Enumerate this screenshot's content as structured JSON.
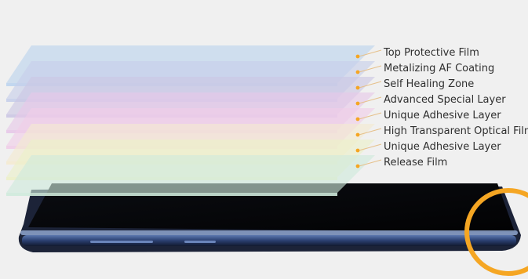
{
  "layers": [
    {
      "label": "Top Protective Film",
      "color": "#bcd4ee"
    },
    {
      "label": "Metalizing AF Coating",
      "color": "#c7cfea"
    },
    {
      "label": "Self Healing Zone",
      "color": "#cbc7e3"
    },
    {
      "label": "Advanced Special Layer",
      "color": "#e7c8e8"
    },
    {
      "label": "Unique Adhesive Layer",
      "color": "#f0cde8"
    },
    {
      "label": "High Transparent Optical Film",
      "color": "#f4ead0"
    },
    {
      "label": "Unique Adhesive Layer",
      "color": "#ecf0c8"
    },
    {
      "label": "Release Film",
      "color": "#cfeadb"
    }
  ],
  "colors": {
    "dot": "#f5a623",
    "highlight_circle": "#f5a623",
    "phone_body": "#1b2238",
    "phone_screen": "#050608"
  }
}
